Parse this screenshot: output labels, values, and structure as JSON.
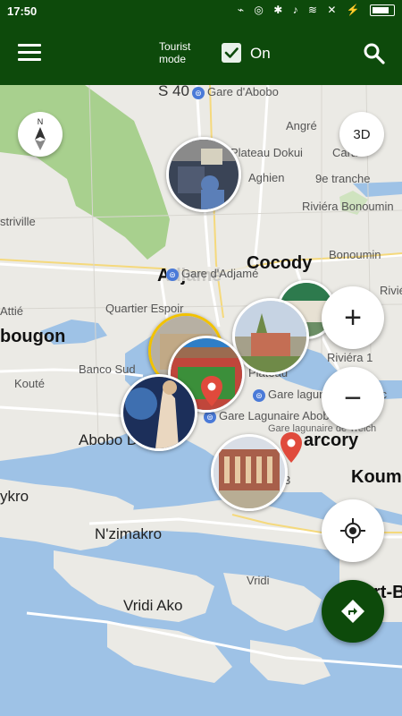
{
  "status_bar": {
    "time": "17:50",
    "icons": "⌁ ◎ ✱ ♪ ≋ ✕ ⚡"
  },
  "app_bar": {
    "menu_icon": "hamburger-menu-icon",
    "tourist_mode_label_line1": "Tourist",
    "tourist_mode_label_line2": "mode",
    "tourist_mode_checked": true,
    "tourist_mode_state": "On",
    "search_icon": "search-icon"
  },
  "map": {
    "compass_label": "N",
    "view_3d_label": "3D",
    "zoom_in_label": "+",
    "zoom_out_label": "−",
    "labels": {
      "s40": "S 40",
      "gare_abobo": "Gare d'Abobo",
      "angre": "Angré",
      "plateau_dokui": "Plateau Dokui",
      "cara": "Cara",
      "agh": "Agh",
      "aghien": "Aghien",
      "neuvieme_tranche": "9e tranche",
      "riviera_bonoumin": "Riviéra Bonoumin",
      "bonoumin": "Bonoumin",
      "striville": "striville",
      "gare_adjame": "Gare d'Adjamé",
      "adjame": "Adjamé",
      "cocody": "Cocody",
      "rivie": "Rivié",
      "quartier_espoir": "Quartier Espoir",
      "attie": "Attié",
      "bougon": "bougon",
      "banco_sud": "Banco Sud",
      "plateau": "Plateau",
      "riviera_1": "Riviéra 1",
      "koute": "Kouté",
      "gare_lagunaire": "Gare lagunaire de Bloc",
      "gare_lagunaire_2": "Gare Lagunaire Abobo",
      "gare_lagunaire_3": "Gare lagunaire de Treich",
      "abobo_doume": "Abobo Doume",
      "marcory": "arcory",
      "koum": "Koum",
      "num3": "3",
      "yokro": "ykro",
      "nzimakro": "N'zimakro",
      "vridi_ako": "Vridi Ako",
      "vridi": "Vridi",
      "port_b": "rt-B"
    }
  },
  "controls": {
    "my_location_icon": "my-location-icon",
    "directions_icon": "directions-icon"
  }
}
